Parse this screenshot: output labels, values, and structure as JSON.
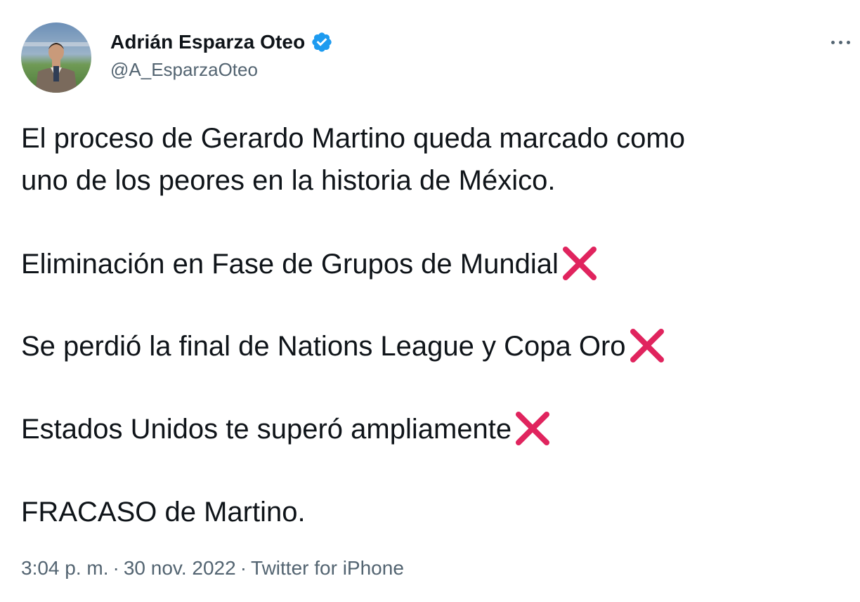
{
  "author": {
    "display_name": "Adrián Esparza Oteo",
    "handle": "@A_EsparzaOteo",
    "verified": true
  },
  "tweet": {
    "line1": "El proceso de Gerardo Martino queda marcado como",
    "line2": "uno de los peores en la historia de México.",
    "item1": "Eliminación en Fase de Grupos de Mundial",
    "item2": "Se perdió la final de Nations League y Copa Oro",
    "item3": "Estados Unidos te superó ampliamente",
    "closing": "FRACASO de Martino."
  },
  "meta": {
    "time": "3:04 p. m.",
    "separator": "·",
    "date": "30 nov. 2022",
    "source": "Twitter for iPhone"
  },
  "icons": {
    "verified": "verified-badge-icon",
    "more": "more-options-icon",
    "cross": "cross-mark-icon"
  },
  "colors": {
    "verified_blue": "#1d9bf0",
    "cross_red": "#e0245e",
    "secondary_text": "#536471"
  }
}
